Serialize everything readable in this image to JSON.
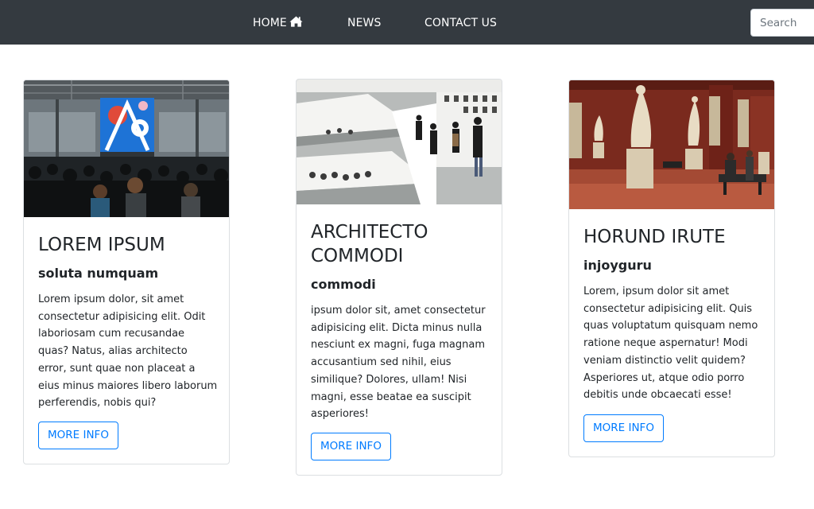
{
  "nav": {
    "home_label": "HOME",
    "news_label": "NEWS",
    "contact_label": "CONTACT US",
    "search_placeholder": "Search"
  },
  "cards": [
    {
      "title": "LOREM IPSUM",
      "subtitle": "soluta numquam",
      "text": "Lorem ipsum dolor, sit amet consectetur adipisicing elit. Odit laboriosam cum recusandae quas? Natus, alias architecto error, sunt quae non placeat a eius minus maiores libero laborum perferendis, nobis qui?",
      "button_label": "MORE INFO"
    },
    {
      "title": "ARCHITECTO COMMODI",
      "subtitle": "commodi",
      "text": "ipsum dolor sit, amet consectetur adipisicing elit. Dicta minus nulla nesciunt ex magni, fuga magnam accusantium sed nihil, eius similique? Dolores, ullam! Nisi magni, esse beatae ea suscipit asperiores!",
      "button_label": "MORE INFO"
    },
    {
      "title": "HORUND IRUTE",
      "subtitle": "injoyguru",
      "text": "Lorem, ipsum dolor sit amet consectetur adipisicing elit. Quis quas voluptatum quisquam nemo ratione neque aspernatur! Modi veniam distinctio velit quidem? Asperiores ut, atque odio porro debitis unde obcaecati esse!",
      "button_label": "MORE INFO"
    }
  ],
  "icons": {
    "home": "home-icon"
  },
  "colors": {
    "navbar": "#343a40",
    "accent": "#007bff"
  }
}
